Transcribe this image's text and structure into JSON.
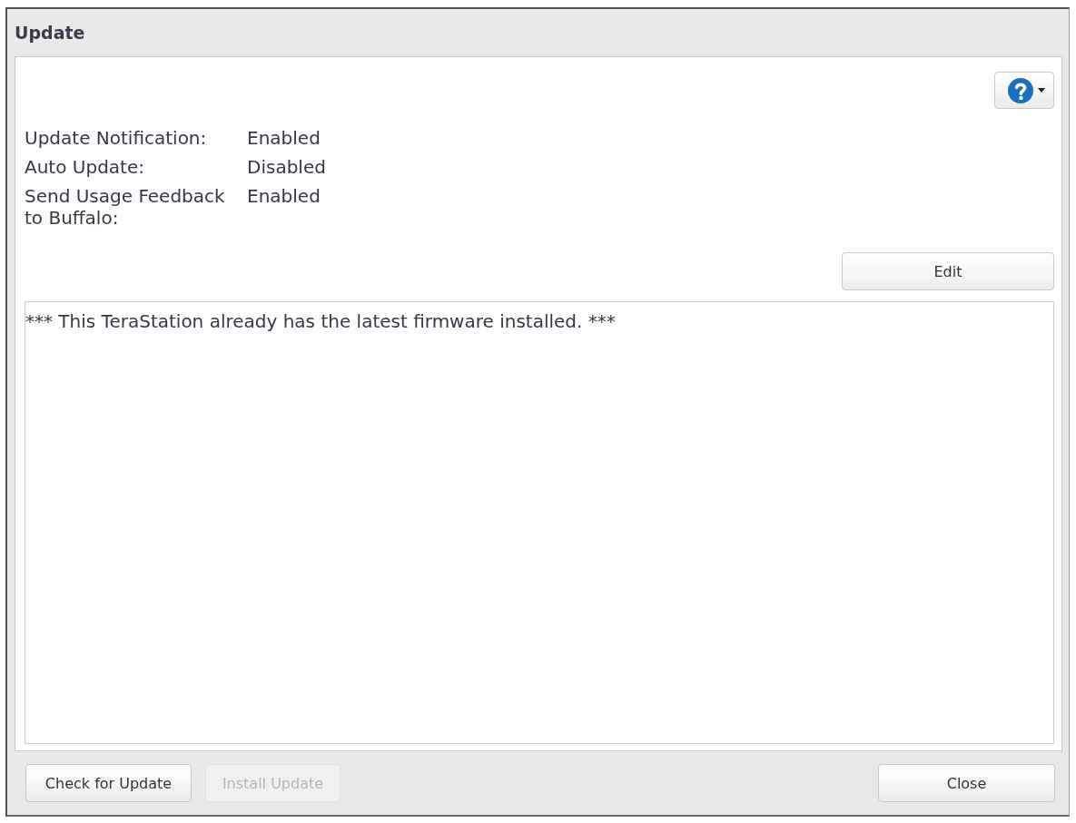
{
  "window": {
    "title": "Update"
  },
  "settings": [
    {
      "label": "Update Notification:",
      "value": "Enabled"
    },
    {
      "label": "Auto Update:",
      "value": "Disabled"
    },
    {
      "label": "Send Usage Feedback to Buffalo:",
      "value": "Enabled"
    }
  ],
  "edit_button": {
    "label": "Edit"
  },
  "log": {
    "text": "*** This TeraStation already has the latest firmware installed. ***"
  },
  "footer": {
    "left_buttons": [
      {
        "label": "Check for Update",
        "disabled": false
      },
      {
        "label": "Install Update",
        "disabled": true
      }
    ],
    "right_buttons": [
      {
        "label": "Close",
        "disabled": false
      }
    ]
  }
}
